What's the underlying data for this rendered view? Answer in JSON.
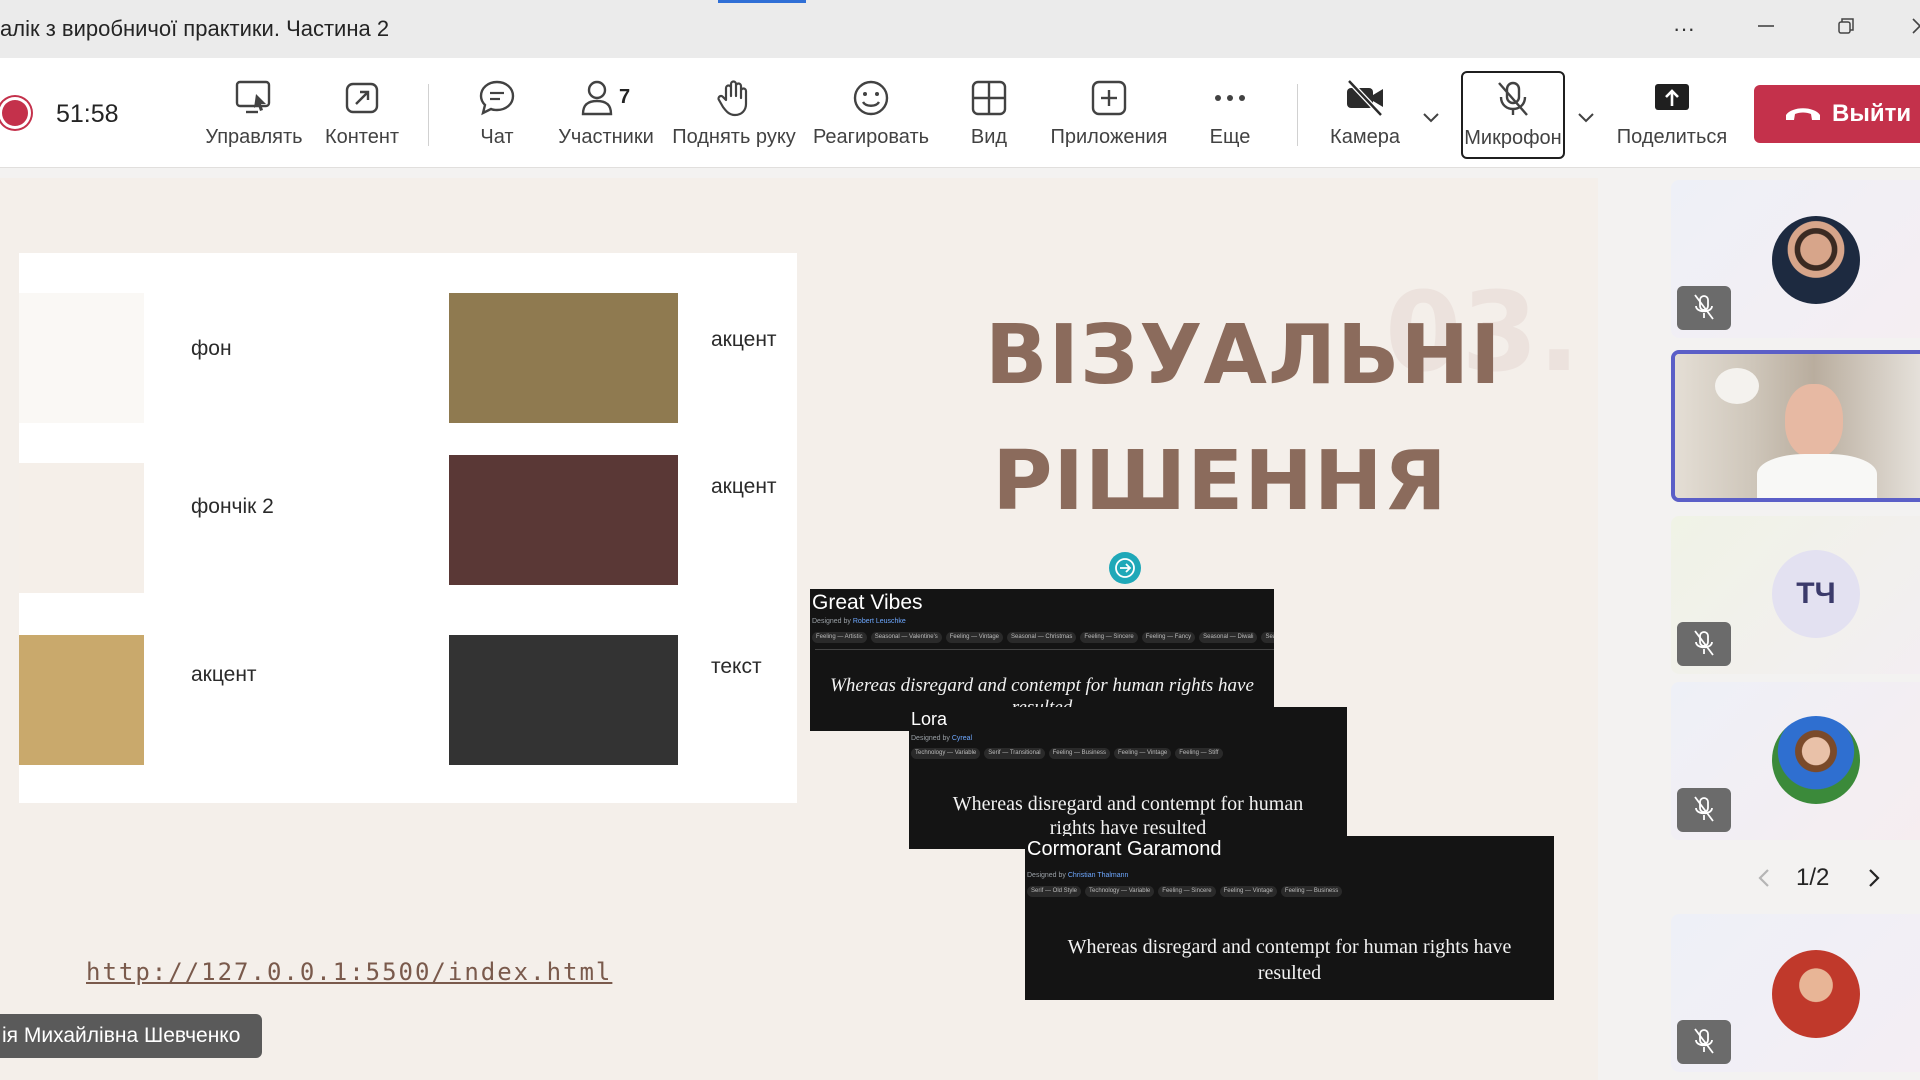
{
  "window": {
    "title": "алік з виробничої практики. Частина 2"
  },
  "toolbar": {
    "timer": "51:58",
    "buttons": {
      "manage": "Управлять",
      "content": "Контент",
      "chat": "Чат",
      "participants": "Участники",
      "participants_count": "7",
      "raise_hand": "Поднять руку",
      "react": "Реагировать",
      "view": "Вид",
      "apps": "Приложения",
      "more": "Еще",
      "camera": "Камера",
      "mic": "Микрофон",
      "share": "Поделиться",
      "leave": "Выйти"
    }
  },
  "slide": {
    "swatches": [
      {
        "label": "фон",
        "color": "#faf8f5"
      },
      {
        "label": "фончік 2",
        "color": "#f5efe9"
      },
      {
        "label": "акцент",
        "color": "#c9a96c"
      },
      {
        "label": "акцент",
        "color": "#8f7a50"
      },
      {
        "label": "акцент",
        "color": "#5a3836"
      },
      {
        "label": "текст",
        "color": "#333333"
      }
    ],
    "heading_line1": "ВІЗУАЛЬНІ",
    "heading_line2": "РІШЕННЯ",
    "bg_number": "03.",
    "fonts": [
      {
        "name": "Great Vibes",
        "designer_prefix": "Designed by",
        "designer": "Robert Leuschke",
        "tags": [
          "Feeling — Artistic",
          "Seasonal — Valentine's",
          "Feeling — Vintage",
          "Seasonal — Christmas",
          "Feeling — Sincere",
          "Feeling — Fancy",
          "Seasonal — Diwali",
          "Seasonal — Lu"
        ],
        "sample": "Whereas disregard and contempt for human rights have resulted"
      },
      {
        "name": "Lora",
        "designer_prefix": "Designed by",
        "designer": "Cyreal",
        "tags": [
          "Technology — Variable",
          "Serif — Transitional",
          "Feeling — Business",
          "Feeling — Vintage",
          "Feeling — Stiff"
        ],
        "sample": "Whereas disregard and contempt for human rights have resulted"
      },
      {
        "name": "Cormorant Garamond",
        "designer_prefix": "Designed by",
        "designer": "Christian Thalmann",
        "tags": [
          "Serif — Old Style",
          "Technology — Variable",
          "Feeling — Sincere",
          "Feeling — Vintage",
          "Feeling — Business"
        ],
        "sample": "Whereas disregard and contempt for human rights have resulted"
      }
    ],
    "url": "http://127.0.0.1:5500/index.html"
  },
  "presenter_name": "ія Михайлівна Шевченко",
  "gallery": {
    "tiles": [
      {
        "type": "photo",
        "muted": true
      },
      {
        "type": "video",
        "muted": false,
        "active": true
      },
      {
        "type": "initials",
        "initials": "ТЧ",
        "muted": true
      },
      {
        "type": "photo",
        "muted": true
      },
      {
        "type": "photo",
        "muted": true
      }
    ],
    "page_indicator": "1/2"
  },
  "colors": {
    "leave_red": "#c4314b",
    "active_tile_border": "#5b5fc7",
    "heading_brown": "#8b6b5c"
  }
}
